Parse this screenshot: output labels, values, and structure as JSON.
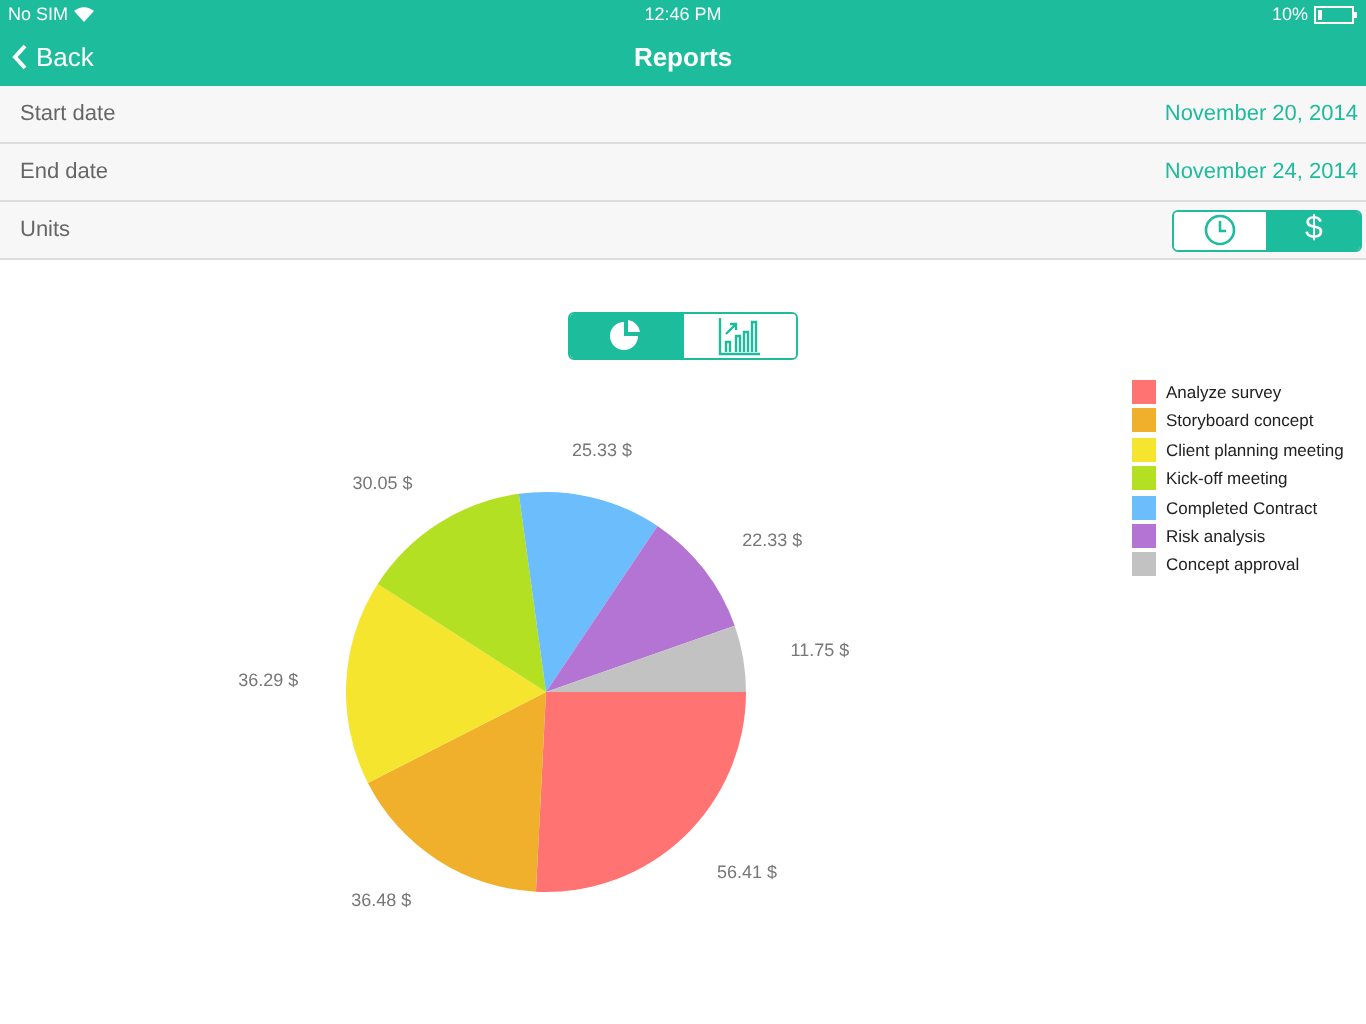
{
  "status_bar": {
    "carrier": "No SIM",
    "time": "12:46 PM",
    "battery": "10%"
  },
  "nav_bar": {
    "back": "Back",
    "title": "Reports"
  },
  "settings": [
    {
      "kind": "value",
      "label": "Start date",
      "value": "November 20, 2014"
    },
    {
      "kind": "value",
      "label": "End date",
      "value": "November 24, 2014"
    },
    {
      "kind": "segments",
      "label": "Units",
      "options": [
        {
          "kind": "clock",
          "selected": false
        },
        {
          "kind": "text",
          "label": "$",
          "selected": true
        }
      ]
    }
  ],
  "chart_type": [
    {
      "kind": "pie",
      "selected": true
    },
    {
      "kind": "bars",
      "selected": false
    }
  ],
  "chart_data": {
    "type": "pie",
    "values": [
      56.41,
      36.48,
      36.29,
      30.05,
      25.33,
      22.33,
      11.75
    ],
    "value_labels": [
      "56.41 $",
      "36.48 $",
      "36.29 $",
      "30.05 $",
      "25.33 $",
      "22.33 $",
      "11.75 $"
    ]
  },
  "legend": [
    {
      "label": "Analyze survey",
      "color": "#ff7373"
    },
    {
      "label": "Storyboard concept",
      "color": "#f0b02c"
    },
    {
      "label": "Client planning meeting",
      "color": "#f5e52f"
    },
    {
      "label": "Kick-off meeting",
      "color": "#b3e022"
    },
    {
      "label": "Completed Contract",
      "color": "#6cbdfc"
    },
    {
      "label": "Risk analysis",
      "color": "#b474d3"
    },
    {
      "label": "Concept approval",
      "color": "#c2c2c2"
    }
  ]
}
